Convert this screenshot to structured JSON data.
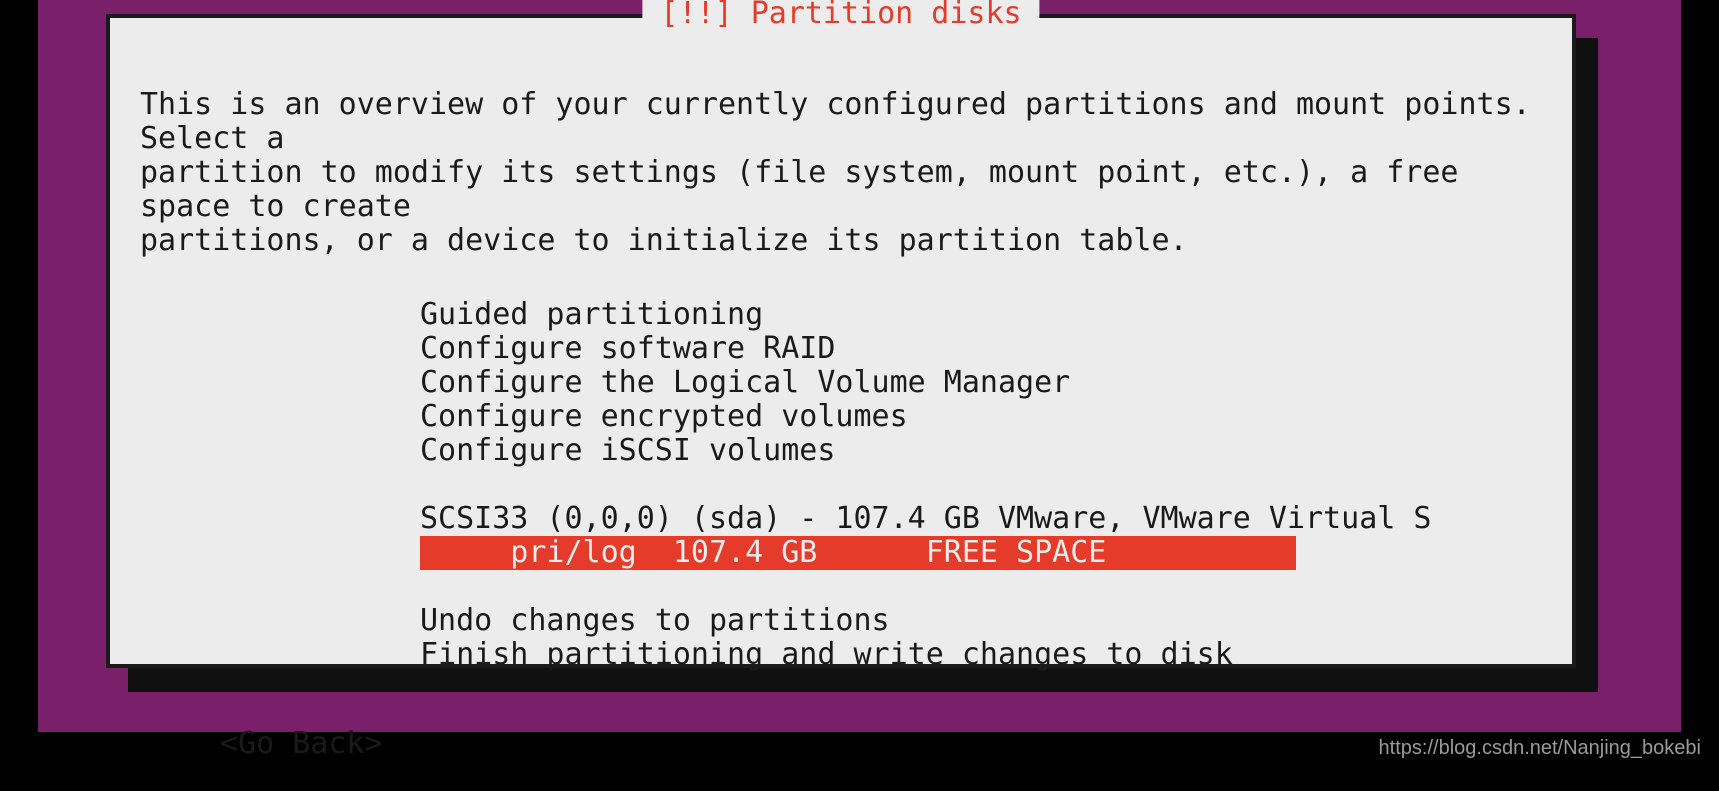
{
  "title": "[!!] Partition disks",
  "description": "This is an overview of your currently configured partitions and mount points. Select a\npartition to modify its settings (file system, mount point, etc.), a free space to create\npartitions, or a device to initialize its partition table.",
  "menu": {
    "guided": "Guided partitioning",
    "raid": "Configure software RAID",
    "lvm": "Configure the Logical Volume Manager",
    "encrypted": "Configure encrypted volumes",
    "iscsi": "Configure iSCSI volumes",
    "disk": "SCSI33 (0,0,0) (sda) - 107.4 GB VMware, VMware Virtual S",
    "free_space": "     pri/log  107.4 GB      FREE SPACE",
    "undo": "Undo changes to partitions",
    "finish": "Finish partitioning and write changes to disk"
  },
  "go_back": "<Go Back>",
  "watermark": "https://blog.csdn.net/Nanjing_bokebi"
}
